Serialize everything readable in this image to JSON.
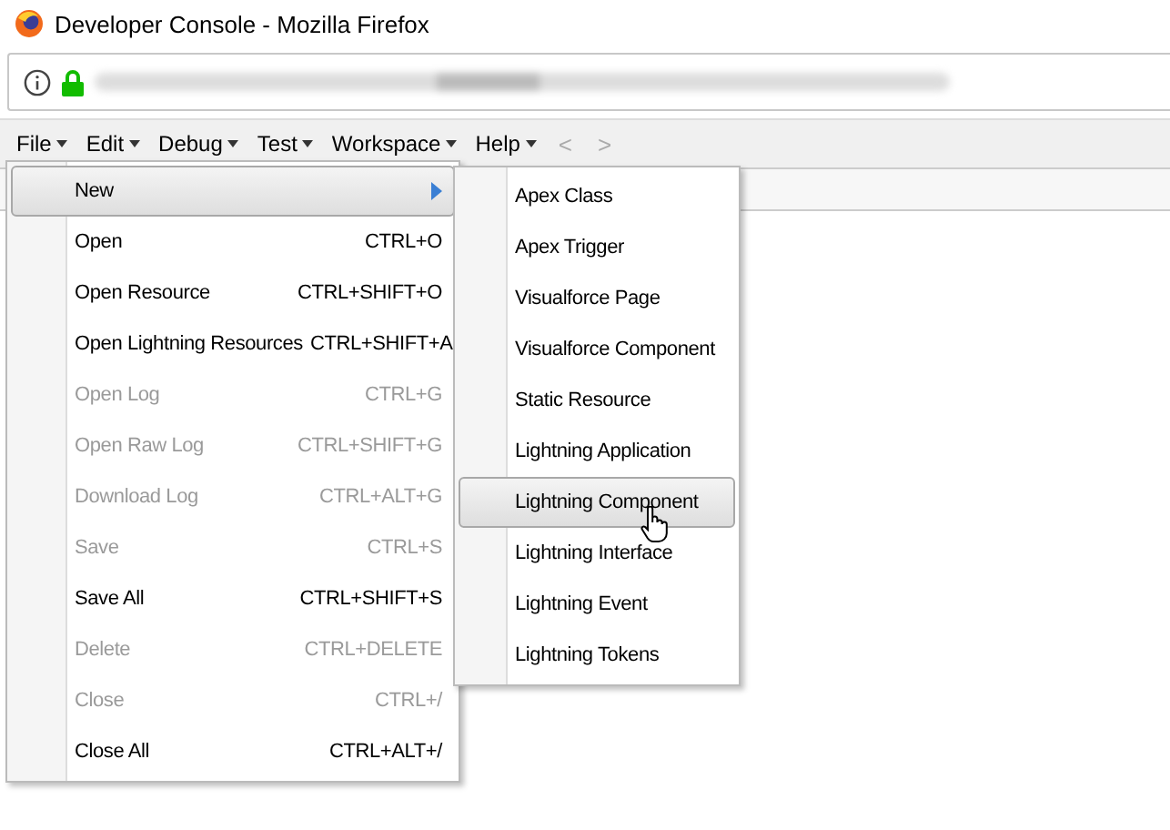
{
  "window": {
    "title": "Developer Console - Mozilla Firefox"
  },
  "menu_bar": {
    "items": [
      {
        "label": "File"
      },
      {
        "label": "Edit"
      },
      {
        "label": "Debug"
      },
      {
        "label": "Test"
      },
      {
        "label": "Workspace"
      },
      {
        "label": "Help"
      }
    ],
    "nav": [
      {
        "label": "<",
        "disabled": true
      },
      {
        "label": ">",
        "disabled": true
      }
    ]
  },
  "file_menu": [
    {
      "kind": "submenu",
      "label": "New",
      "selected": true,
      "disabled": false
    },
    {
      "kind": "item",
      "label": "Open",
      "shortcut": "CTRL+O",
      "selected": false,
      "disabled": false
    },
    {
      "kind": "item",
      "label": "Open Resource",
      "shortcut": "CTRL+SHIFT+O",
      "selected": false,
      "disabled": false
    },
    {
      "kind": "item",
      "label": "Open Lightning Resources",
      "shortcut": "CTRL+SHIFT+A",
      "selected": false,
      "disabled": false
    },
    {
      "kind": "item",
      "label": "Open Log",
      "shortcut": "CTRL+G",
      "selected": false,
      "disabled": true
    },
    {
      "kind": "item",
      "label": "Open Raw Log",
      "shortcut": "CTRL+SHIFT+G",
      "selected": false,
      "disabled": true
    },
    {
      "kind": "item",
      "label": "Download Log",
      "shortcut": "CTRL+ALT+G",
      "selected": false,
      "disabled": true
    },
    {
      "kind": "item",
      "label": "Save",
      "shortcut": "CTRL+S",
      "selected": false,
      "disabled": true
    },
    {
      "kind": "item",
      "label": "Save All",
      "shortcut": "CTRL+SHIFT+S",
      "selected": false,
      "disabled": false
    },
    {
      "kind": "item",
      "label": "Delete",
      "shortcut": "CTRL+DELETE",
      "selected": false,
      "disabled": true
    },
    {
      "kind": "item",
      "label": "Close",
      "shortcut": "CTRL+/",
      "selected": false,
      "disabled": true
    },
    {
      "kind": "item",
      "label": "Close All",
      "shortcut": "CTRL+ALT+/",
      "selected": false,
      "disabled": false
    }
  ],
  "new_submenu": [
    {
      "label": "Apex Class",
      "selected": false
    },
    {
      "label": "Apex Trigger",
      "selected": false
    },
    {
      "label": "Visualforce Page",
      "selected": false
    },
    {
      "label": "Visualforce Component",
      "selected": false
    },
    {
      "label": "Static Resource",
      "selected": false
    },
    {
      "label": "Lightning Application",
      "selected": false
    },
    {
      "label": "Lightning Component",
      "selected": true
    },
    {
      "label": "Lightning Interface",
      "selected": false
    },
    {
      "label": "Lightning Event",
      "selected": false
    },
    {
      "label": "Lightning Tokens",
      "selected": false
    }
  ]
}
